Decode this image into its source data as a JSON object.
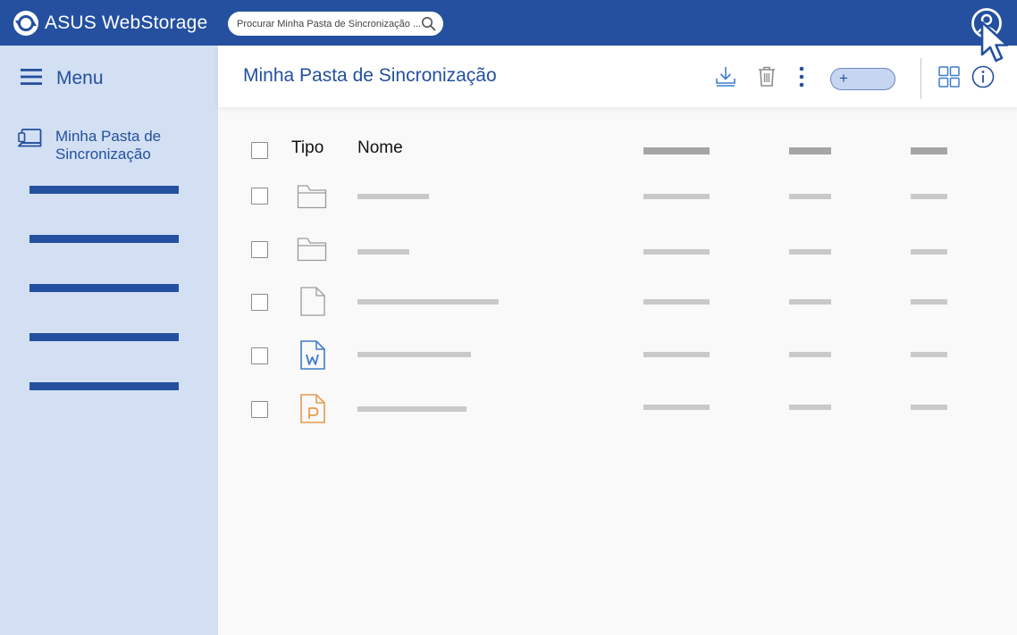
{
  "topbar": {
    "brand_text": "ASUS WebStorage",
    "search_placeholder": "Procurar Minha Pasta de Sincronização ..."
  },
  "sidebar": {
    "menu_label": "Menu",
    "active_item_label": "Minha Pasta de Sincronização",
    "placeholder_nav_items": 5
  },
  "header": {
    "title": "Minha Pasta de Sincronização",
    "add_button_label": "+"
  },
  "table": {
    "headers": {
      "type": "Tipo",
      "name": "Nome"
    },
    "rows": [
      {
        "icon": "folder-icon"
      },
      {
        "icon": "folder-icon"
      },
      {
        "icon": "file-icon"
      },
      {
        "icon": "word-file-icon"
      },
      {
        "icon": "powerpoint-file-icon"
      }
    ]
  },
  "colors": {
    "brand_blue": "#24509f",
    "sidebar_bg": "#d3e0f3",
    "word_blue": "#3f7cc9",
    "powerpoint_orange": "#e59a4f",
    "placeholder_gray": "#c9c9c9"
  }
}
